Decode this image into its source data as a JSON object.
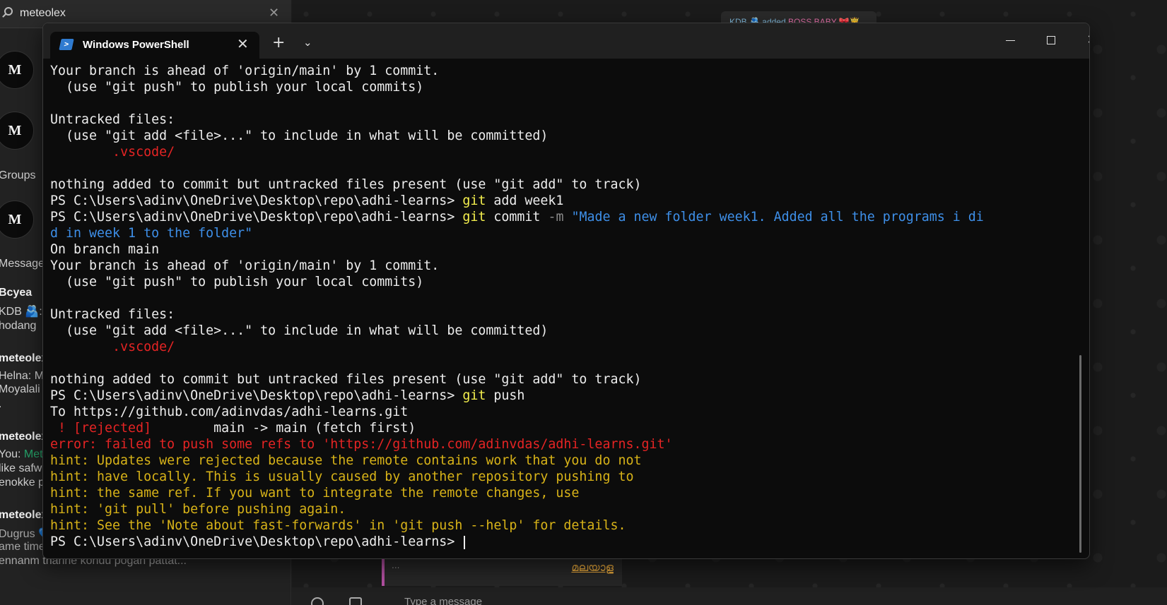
{
  "background_app": {
    "search": {
      "value": "meteolex",
      "clear_icon": "close-icon"
    },
    "avatar_letter": "M",
    "sidebar_lines": [
      {
        "text": "Groups",
        "style": "normal"
      },
      {
        "text": "Message",
        "style": "normal"
      },
      {
        "text": "Bcyea",
        "style": "bold"
      },
      {
        "text": "KDB 🫂: ",
        "style": "normal"
      },
      {
        "text": "hodang",
        "style": "normal"
      },
      {
        "text": "meteolex",
        "style": "bold"
      },
      {
        "text": "Helna: M",
        "style": "normal"
      },
      {
        "text": "Moyalali",
        "style": "normal"
      },
      {
        "text": ".",
        "style": "normal"
      },
      {
        "text": "meteolex",
        "style": "bold"
      },
      {
        "text": "You: ",
        "style": "normal",
        "green": "Met"
      },
      {
        "text": "like safw",
        "style": "normal"
      },
      {
        "text": "enokke p",
        "style": "normal"
      },
      {
        "text": "meteolex",
        "style": "bold"
      },
      {
        "text": "Dugrus 💙: Eda.. mone.. ithrem project",
        "style": "dim"
      },
      {
        "text": "ame time il paper work um okke ayittu",
        "style": "dim"
      },
      {
        "text": " ennanm thanne kondu pogan  pattat...",
        "style": "dim"
      }
    ],
    "pill": {
      "prefix": "KDB 🫂 added ",
      "name": "BOSS BABY 🎀🤴"
    },
    "msg_fragment": {
      "dots": "...",
      "malayalam": "മലയാള"
    },
    "type_placeholder": "Type a message"
  },
  "terminal": {
    "tab_title": "Windows PowerShell",
    "tab_icon": "powershell-icon",
    "new_tab": "+",
    "dropdown": "⌄",
    "window_controls": [
      "minimize-icon",
      "maximize-icon",
      "close-icon"
    ],
    "lines": [
      [
        {
          "t": "Your branch is ahead of 'origin/main' by 1 commit."
        }
      ],
      [
        {
          "t": "  (use \"git push\" to publish your local commits)"
        }
      ],
      [
        {
          "t": ""
        }
      ],
      [
        {
          "t": "Untracked files:"
        }
      ],
      [
        {
          "t": "  (use \"git add <file>...\" to include in what will be committed)"
        }
      ],
      [
        {
          "t": "        "
        },
        {
          "t": ".vscode/",
          "c": "red"
        }
      ],
      [
        {
          "t": ""
        }
      ],
      [
        {
          "t": "nothing added to commit but untracked files present (use \"git add\" to track)"
        }
      ],
      [
        {
          "t": "PS C:\\Users\\adinv\\OneDrive\\Desktop\\repo\\adhi-learns> "
        },
        {
          "t": "git",
          "c": "yellow"
        },
        {
          "t": " add week1"
        }
      ],
      [
        {
          "t": "PS C:\\Users\\adinv\\OneDrive\\Desktop\\repo\\adhi-learns> "
        },
        {
          "t": "git",
          "c": "yellow"
        },
        {
          "t": " commit "
        },
        {
          "t": "-m",
          "c": "gray"
        },
        {
          "t": " \"Made a new folder week1. Added all the programs i di",
          "c": "blue"
        }
      ],
      [
        {
          "t": "d in week 1 to the folder\"",
          "c": "blue"
        }
      ],
      [
        {
          "t": "On branch main"
        }
      ],
      [
        {
          "t": "Your branch is ahead of 'origin/main' by 1 commit."
        }
      ],
      [
        {
          "t": "  (use \"git push\" to publish your local commits)"
        }
      ],
      [
        {
          "t": ""
        }
      ],
      [
        {
          "t": "Untracked files:"
        }
      ],
      [
        {
          "t": "  (use \"git add <file>...\" to include in what will be committed)"
        }
      ],
      [
        {
          "t": "        "
        },
        {
          "t": ".vscode/",
          "c": "red"
        }
      ],
      [
        {
          "t": ""
        }
      ],
      [
        {
          "t": "nothing added to commit but untracked files present (use \"git add\" to track)"
        }
      ],
      [
        {
          "t": "PS C:\\Users\\adinv\\OneDrive\\Desktop\\repo\\adhi-learns> "
        },
        {
          "t": "git",
          "c": "yellow"
        },
        {
          "t": " push"
        }
      ],
      [
        {
          "t": "To https://github.com/adinvdas/adhi-learns.git"
        }
      ],
      [
        {
          "t": " ! [rejected]",
          "c": "red"
        },
        {
          "t": "        main -> main (fetch first)"
        }
      ],
      [
        {
          "t": "error: failed to push some refs to 'https://github.com/adinvdas/adhi-learns.git'",
          "c": "red"
        }
      ],
      [
        {
          "t": "hint: Updates were rejected because the remote contains work that you do not",
          "c": "hint"
        }
      ],
      [
        {
          "t": "hint: have locally. This is usually caused by another repository pushing to",
          "c": "hint"
        }
      ],
      [
        {
          "t": "hint: the same ref. If you want to integrate the remote changes, use",
          "c": "hint"
        }
      ],
      [
        {
          "t": "hint: 'git pull' before pushing again.",
          "c": "hint"
        }
      ],
      [
        {
          "t": "hint: See the 'Note about fast-forwards' in 'git push --help' for details.",
          "c": "hint"
        }
      ],
      [
        {
          "t": "PS C:\\Users\\adinv\\OneDrive\\Desktop\\repo\\adhi-learns> "
        }
      ]
    ]
  }
}
